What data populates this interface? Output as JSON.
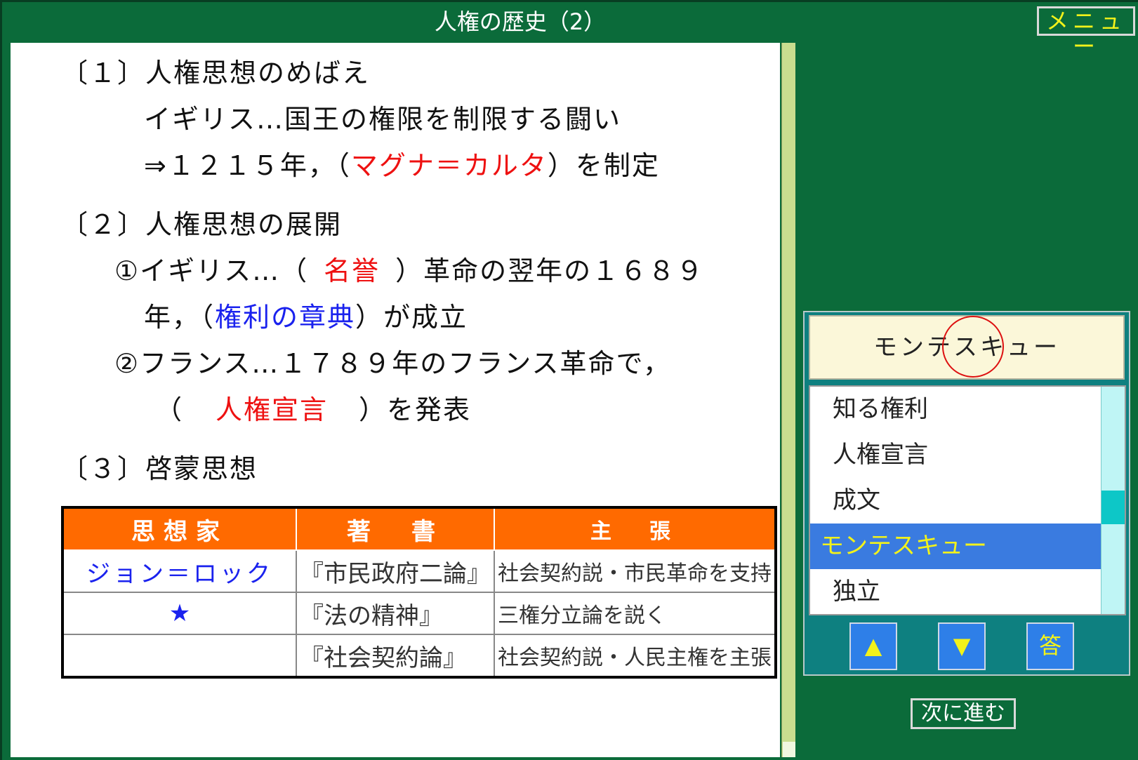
{
  "title": "人権の歴史（2）",
  "menu_label": "メニュー",
  "sections": {
    "s1_heading": "〔１〕人権思想のめばえ",
    "s1_line1": "イギリス…国王の権限を制限する闘い",
    "s1_line2_prefix": "⇒１２１５年，（",
    "s1_line2_answer": "マグナ＝カルタ",
    "s1_line2_suffix": "）を制定",
    "s2_heading": "〔２〕人権思想の展開",
    "s2_item1_prefix": "①イギリス…（",
    "s2_item1_answer": "名誉",
    "s2_item1_suffix": "）革命の翌年の１６８９",
    "s2_item1b_prefix": "年，（",
    "s2_item1b_answer": "権利の章典",
    "s2_item1b_suffix": "）が成立",
    "s2_item2": "②フランス…１７８９年のフランス革命で，",
    "s2_item2b_prefix": "（",
    "s2_item2b_answer": "人権宣言",
    "s2_item2b_suffix": "）を発表",
    "s3_heading": "〔３〕啓蒙思想"
  },
  "table": {
    "headers": [
      "思想家",
      "著　書",
      "主　張"
    ],
    "rows": [
      {
        "thinker": "ジョン＝ロック",
        "book": "『市民政府二論』",
        "claim": "社会契約説・市民革命を支持"
      },
      {
        "thinker": "★",
        "book": "『法の精神』",
        "claim": "三権分立論を説く"
      },
      {
        "thinker": "",
        "book": "『社会契約論』",
        "claim": "社会契約説・人民主権を主張"
      }
    ]
  },
  "answer_panel": {
    "current_answer": "モンテスキュー",
    "options": [
      "知る権利",
      "人権宣言",
      "成文",
      "モンテスキュー",
      "独立"
    ],
    "selected_index": 3,
    "up_label": "▲",
    "down_label": "▼",
    "answer_button_label": "答"
  },
  "next_button_label": "次に進む"
}
